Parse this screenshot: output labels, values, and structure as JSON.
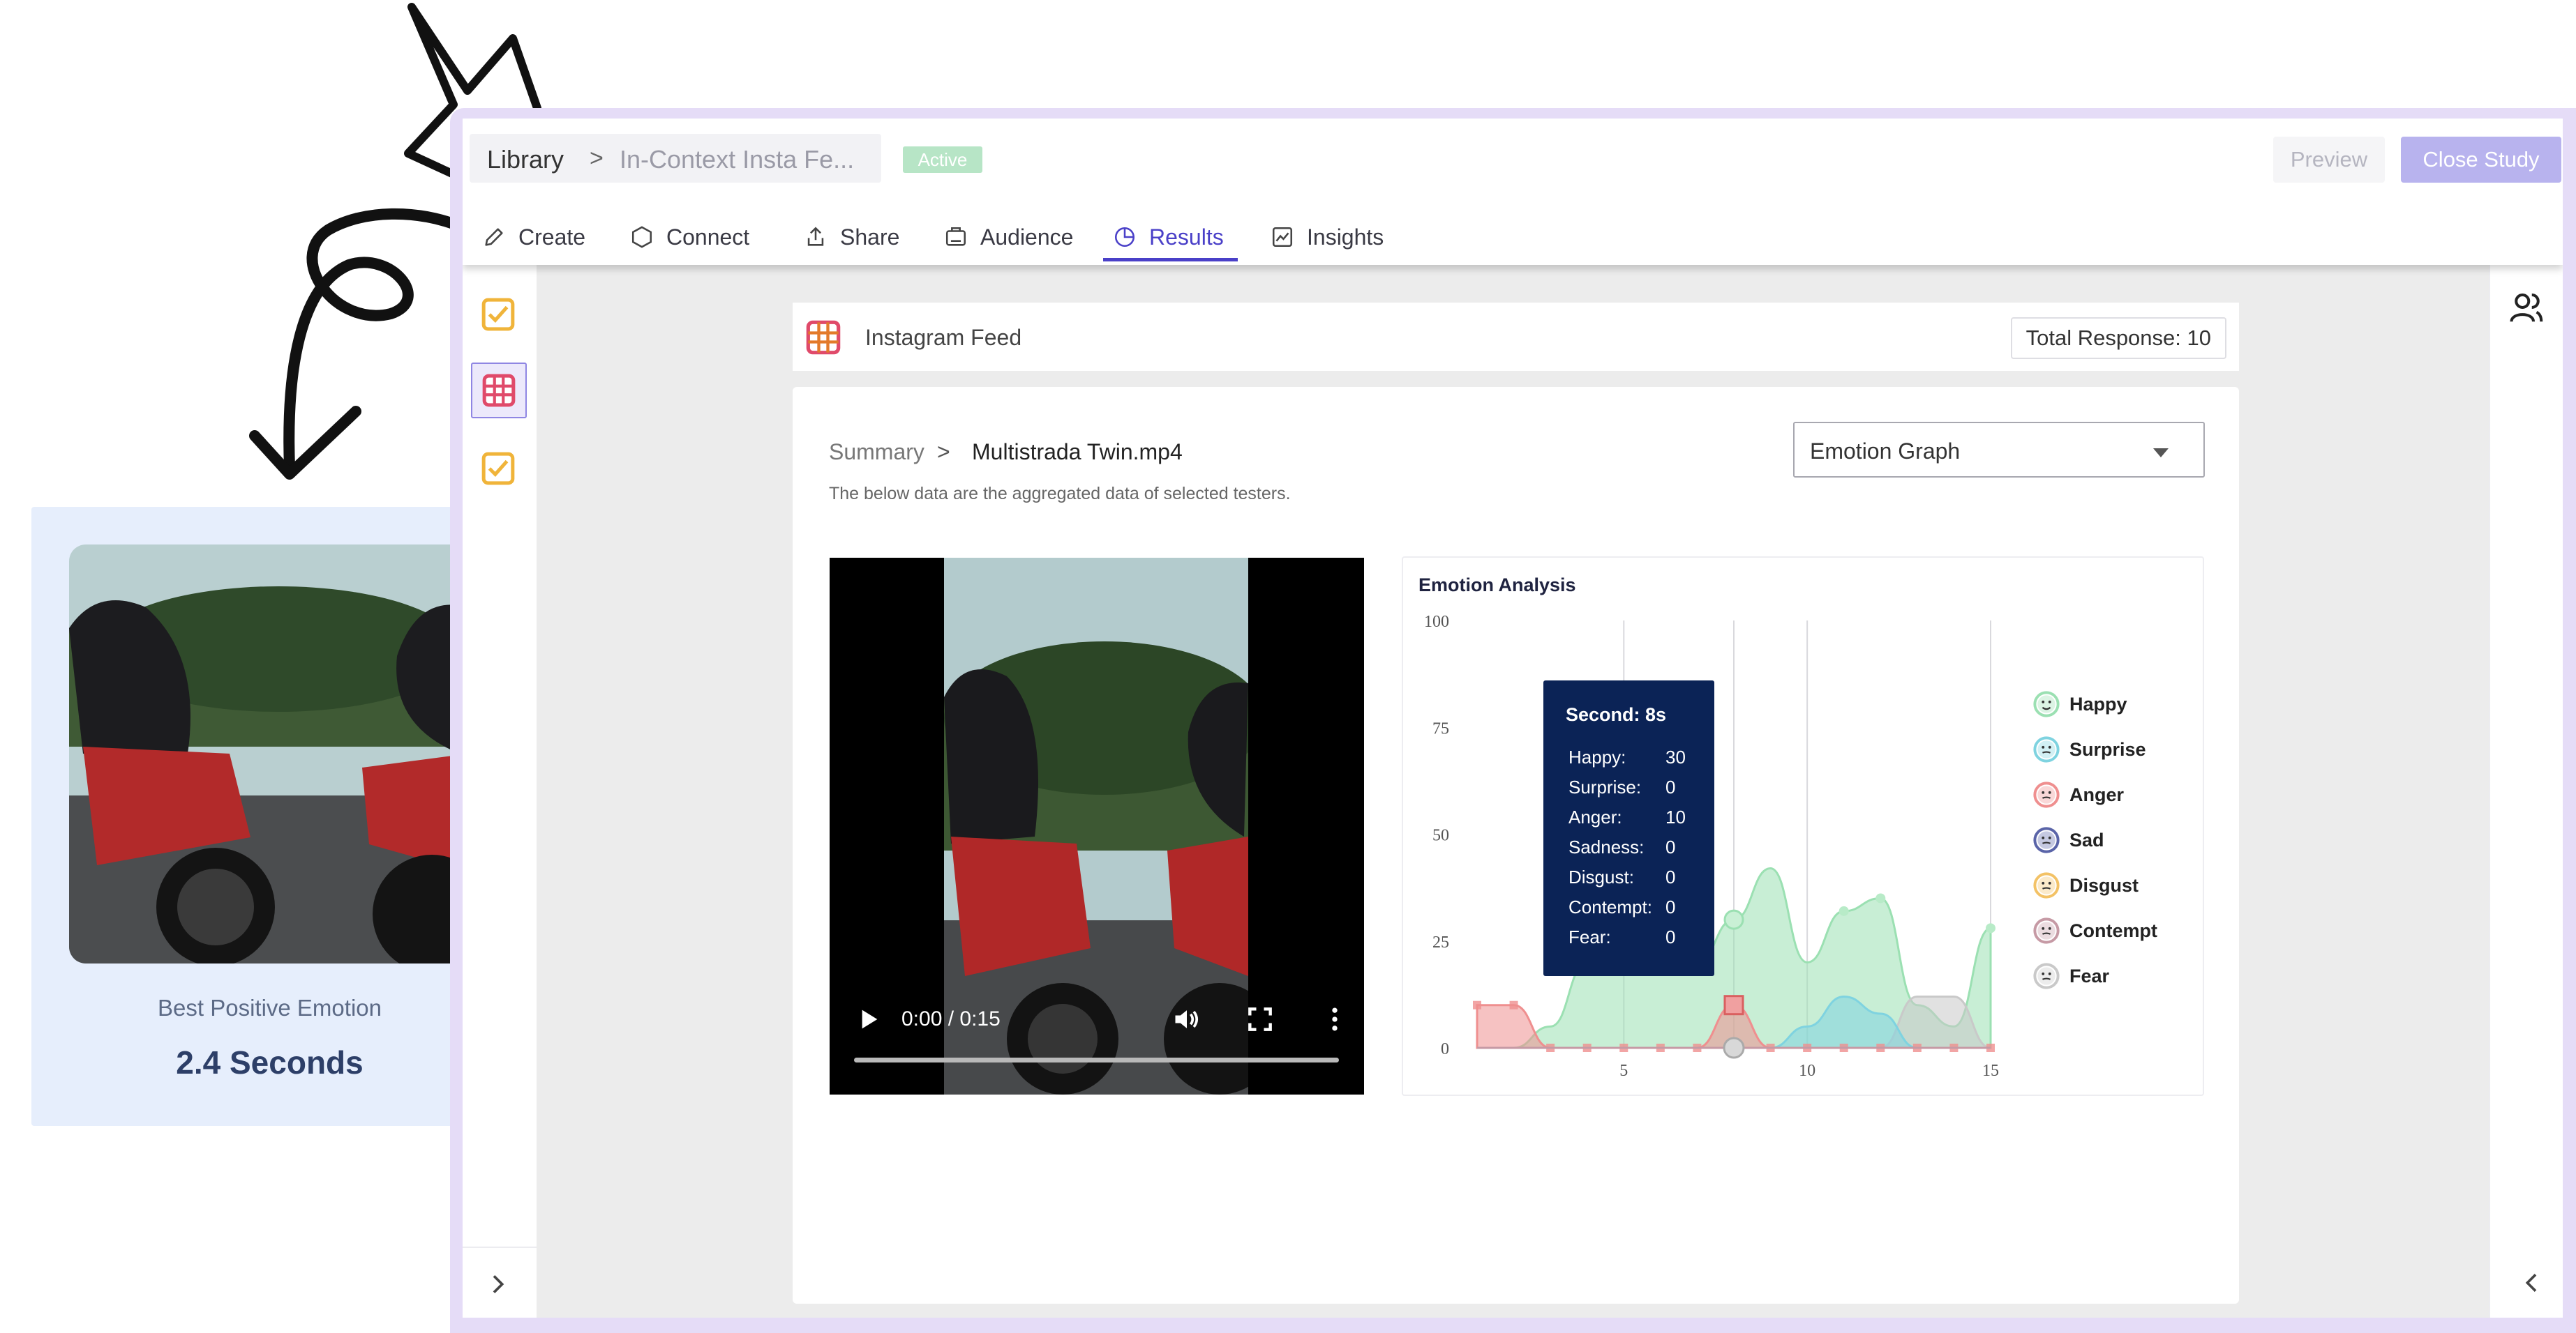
{
  "callout": {
    "caption": "Best Positive Emotion",
    "value": "2.4 Seconds"
  },
  "header": {
    "breadcrumb_root": "Library",
    "breadcrumb_sep": ">",
    "study_title": "In-Context Insta Fe...",
    "status_badge": "Active",
    "preview_label": "Preview",
    "close_label": "Close Study"
  },
  "tabs": [
    {
      "label": "Create",
      "icon": "pencil-icon"
    },
    {
      "label": "Connect",
      "icon": "hexagon-icon"
    },
    {
      "label": "Share",
      "icon": "share-icon"
    },
    {
      "label": "Audience",
      "icon": "audience-icon"
    },
    {
      "label": "Results",
      "icon": "pie-chart-icon",
      "active": true
    },
    {
      "label": "Insights",
      "icon": "line-chart-icon"
    }
  ],
  "feed": {
    "title": "Instagram Feed",
    "total_response": "Total Response: 10"
  },
  "panel": {
    "summary_label": "Summary",
    "sep": ">",
    "file_name": "Multistrada Twin.mp4",
    "description": "The below data are the aggregated data of selected testers.",
    "view_select": "Emotion Graph"
  },
  "video": {
    "time": "0:00 / 0:15",
    "progress": 0
  },
  "tooltip": {
    "title": "Second: 8s",
    "rows": [
      {
        "label": "Happy:",
        "value": "30"
      },
      {
        "label": "Surprise:",
        "value": "0"
      },
      {
        "label": "Anger:",
        "value": "10"
      },
      {
        "label": "Sadness:",
        "value": "0"
      },
      {
        "label": "Disgust:",
        "value": "0"
      },
      {
        "label": "Contempt:",
        "value": "0"
      },
      {
        "label": "Fear:",
        "value": "0"
      }
    ]
  },
  "chart_data": {
    "type": "area",
    "title": "Emotion Analysis",
    "x": [
      1,
      2,
      3,
      4,
      5,
      6,
      7,
      8,
      9,
      10,
      11,
      12,
      13,
      14,
      15
    ],
    "xticks": [
      5,
      10,
      15
    ],
    "yticks": [
      0,
      25,
      50,
      75,
      100
    ],
    "xlim": [
      1,
      15
    ],
    "ylim": [
      0,
      100
    ],
    "legend_position": "right",
    "series": [
      {
        "name": "Happy",
        "color": "#9be0b2",
        "values": [
          0,
          0,
          5,
          20,
          32,
          26,
          20,
          30,
          42,
          20,
          32,
          35,
          10,
          5,
          28
        ]
      },
      {
        "name": "Surprise",
        "color": "#7fd3e0",
        "values": [
          0,
          0,
          0,
          0,
          0,
          0,
          0,
          0,
          0,
          5,
          12,
          8,
          0,
          0,
          0
        ]
      },
      {
        "name": "Anger",
        "color": "#ef8f8f",
        "values": [
          10,
          10,
          0,
          0,
          0,
          0,
          0,
          10,
          0,
          0,
          0,
          0,
          0,
          0,
          0
        ]
      },
      {
        "name": "Sad",
        "color": "#5a64a8",
        "values": [
          0,
          0,
          0,
          0,
          0,
          0,
          0,
          0,
          0,
          0,
          0,
          0,
          0,
          0,
          0
        ]
      },
      {
        "name": "Disgust",
        "color": "#f3c266",
        "values": [
          0,
          0,
          0,
          0,
          0,
          0,
          0,
          0,
          0,
          0,
          0,
          0,
          0,
          0,
          0
        ]
      },
      {
        "name": "Contempt",
        "color": "#c69aa5",
        "values": [
          0,
          0,
          0,
          0,
          0,
          0,
          0,
          0,
          0,
          0,
          0,
          0,
          0,
          0,
          0
        ]
      },
      {
        "name": "Fear",
        "color": "#c9c9c9",
        "values": [
          0,
          0,
          0,
          0,
          0,
          0,
          0,
          0,
          0,
          0,
          0,
          0,
          12,
          12,
          0
        ]
      }
    ],
    "highlight_x": 8,
    "vertical_guides": [
      5,
      8,
      10,
      15
    ]
  }
}
